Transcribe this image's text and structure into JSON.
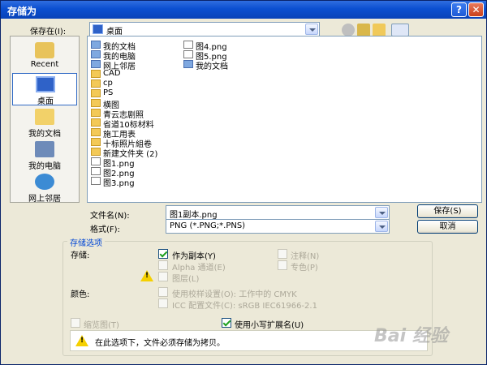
{
  "window": {
    "title": "存储为",
    "help_label": "?",
    "close_label": "✕"
  },
  "save_in": {
    "label": "保存在(I):",
    "value": "桌面"
  },
  "toolbar": {
    "icons": [
      "back-icon",
      "up-icon",
      "new-folder-icon",
      "views-icon"
    ]
  },
  "places": [
    {
      "label": "Recent",
      "icon": "recent-icon"
    },
    {
      "label": "桌面",
      "icon": "desktop-icon",
      "selected": true
    },
    {
      "label": "我的文档",
      "icon": "my-documents-icon"
    },
    {
      "label": "我的电脑",
      "icon": "my-computer-icon"
    },
    {
      "label": "网上邻居",
      "icon": "network-icon"
    }
  ],
  "files": [
    {
      "name": "我的文档",
      "type": "sys"
    },
    {
      "name": "我的电脑",
      "type": "sys"
    },
    {
      "name": "网上邻居",
      "type": "sys"
    },
    {
      "name": "CAD",
      "type": "folder"
    },
    {
      "name": "cp",
      "type": "folder"
    },
    {
      "name": "PS",
      "type": "folder"
    },
    {
      "name": "横图",
      "type": "folder"
    },
    {
      "name": "青云志剧照",
      "type": "folder"
    },
    {
      "name": "省道10标材料",
      "type": "folder"
    },
    {
      "name": "施工用表",
      "type": "folder"
    },
    {
      "name": "十标照片組卷",
      "type": "folder"
    },
    {
      "name": "新建文件夹 (2)",
      "type": "folder"
    },
    {
      "name": "图1.png",
      "type": "png"
    },
    {
      "name": "图2.png",
      "type": "png"
    },
    {
      "name": "图3.png",
      "type": "png"
    },
    {
      "name": "图4.png",
      "type": "png"
    },
    {
      "name": "图5.png",
      "type": "png"
    },
    {
      "name": "我的文档",
      "type": "sys"
    }
  ],
  "filename": {
    "label": "文件名(N):",
    "value": "图1副本.png"
  },
  "format": {
    "label": "格式(F):",
    "value": "PNG (*.PNG;*.PNS)"
  },
  "buttons": {
    "save": "保存(S)",
    "cancel": "取消"
  },
  "options": {
    "legend": "存储选项",
    "save_label": "存储:",
    "as_copy": "作为副本(Y)",
    "notes": "注释(N)",
    "alpha": "Alpha 通道(E)",
    "spot": "专色(P)",
    "layers": "图层(L)",
    "color_label": "颜色:",
    "proof": "使用校样设置(O):  工作中的 CMYK",
    "icc": "ICC 配置文件(C):  sRGB IEC61966-2.1",
    "thumbnail": "缩览图(T)",
    "lowercase_ext": "使用小写扩展名(U)",
    "warning": "在此选项下，文件必须存储为拷贝。"
  },
  "watermark": "Bai 经验"
}
